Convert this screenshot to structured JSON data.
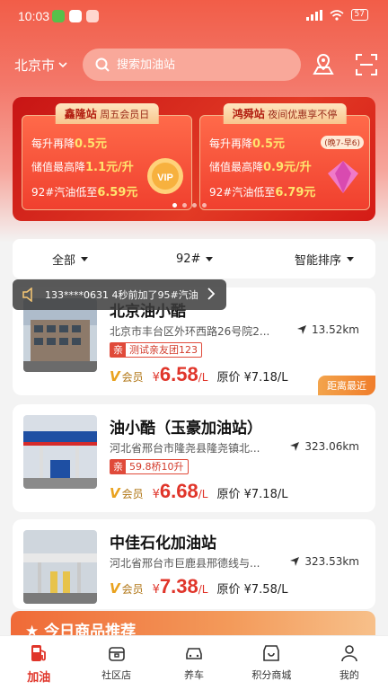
{
  "status": {
    "time": "10:03",
    "battery": "57"
  },
  "header": {
    "city": "北京市",
    "search_placeholder": "搜索加油站"
  },
  "banner": {
    "left": {
      "station": "鑫隆站",
      "event": "周五会员日",
      "line1_pre": "每升再降",
      "line1_val": "0.5元",
      "line2_pre": "储值最高降",
      "line2_val": "1.1元/升",
      "line3_pre": "92#汽油低至",
      "line3_val": "6.59元",
      "deco": "VIP"
    },
    "right": {
      "station": "鸿舜站",
      "event": "夜间优惠享不停",
      "tag": "(晚7-早6)",
      "line1_pre": "每升再降",
      "line1_val": "0.5元",
      "line2_pre": "储值最高降",
      "line2_val": "0.9元/升",
      "line3_pre": "92#汽油低至",
      "line3_val": "6.79元"
    }
  },
  "filter": {
    "all": "全部",
    "fuel": "92#",
    "sort": "智能排序"
  },
  "ticker": {
    "text": "133****0631 4秒前加了95#汽油"
  },
  "stations": [
    {
      "name": "北京油小酷",
      "address": "北京市丰台区外环西路26号院2...",
      "distance": "13.52km",
      "tag_key": "亲",
      "tag_val": "测试亲友团123",
      "vip": "会员",
      "currency": "¥",
      "price": "6.58",
      "unit": "/L",
      "orig_label": "原价",
      "orig_price": "¥7.18/L",
      "badge": "距离最近"
    },
    {
      "name": "油小酷（玉豪加油站）",
      "address": "河北省邢台市隆尧县隆尧镇北...",
      "distance": "323.06km",
      "tag_key": "亲",
      "tag_val": "59.8桥10升",
      "vip": "会员",
      "currency": "¥",
      "price": "6.68",
      "unit": "/L",
      "orig_label": "原价",
      "orig_price": "¥7.18/L"
    },
    {
      "name": "中佳石化加油站",
      "address": "河北省邢台市巨鹿县邢德线与...",
      "distance": "323.53km",
      "vip": "会员",
      "currency": "¥",
      "price": "7.38",
      "unit": "/L",
      "orig_label": "原价",
      "orig_price": "¥7.58/L"
    }
  ],
  "reco": {
    "title": "今日商品推荐"
  },
  "tabs": [
    {
      "label": "加油"
    },
    {
      "label": "社区店"
    },
    {
      "label": "养车"
    },
    {
      "label": "积分商城"
    },
    {
      "label": "我的"
    }
  ]
}
